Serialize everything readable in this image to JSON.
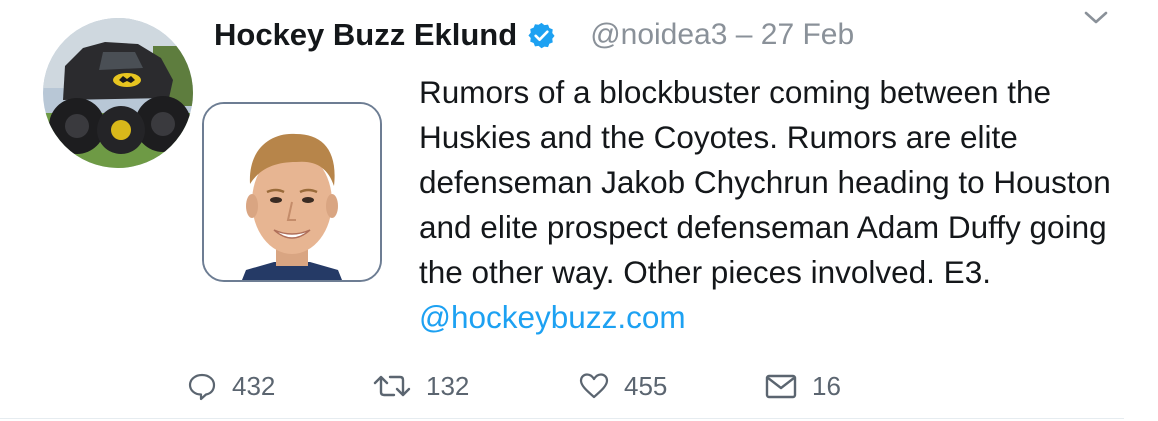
{
  "user": {
    "display_name": "Hockey Buzz Eklund",
    "verified": true,
    "handle_date": "@noidea3 – 27 Feb",
    "avatar_icon": "monster-truck-avatar"
  },
  "tweet": {
    "text": "Rumors of a blockbuster coming between the Huskies and the Coyotes. Rumors are elite defenseman Jakob Chychrun heading to Houston and elite prospect defenseman Adam Duffy going the other way. Other pieces involved. E3.",
    "link": "@hockeybuzz.com",
    "media_icon": "player-headshot"
  },
  "actions": {
    "replies": "432",
    "retweets": "132",
    "likes": "455",
    "dm": "16"
  },
  "colors": {
    "link": "#1da1f2",
    "verified": "#1da1f2",
    "muted": "#8a9199",
    "text": "#14171a"
  }
}
